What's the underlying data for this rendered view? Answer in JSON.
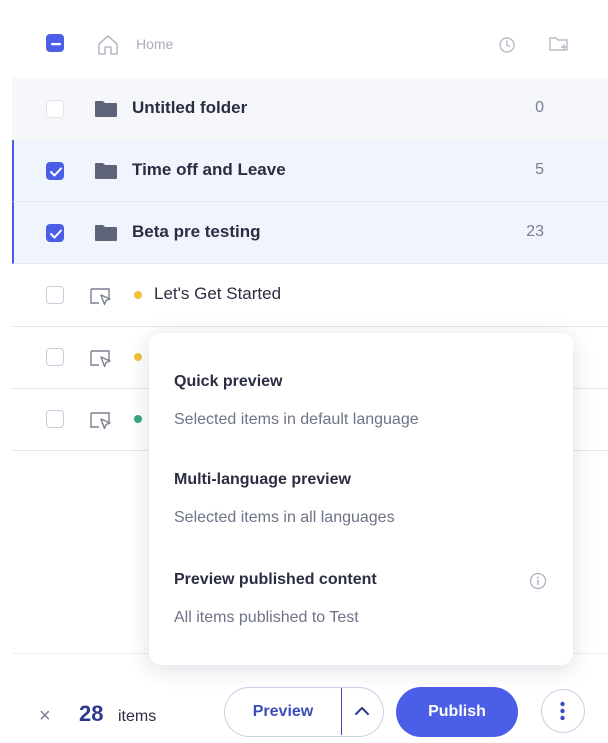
{
  "header": {
    "home_label": "Home",
    "icons": [
      "home-icon",
      "history-icon",
      "new-folder-icon"
    ]
  },
  "rows": [
    {
      "type": "folder",
      "name": "Untitled folder",
      "count": "0",
      "checked": false
    },
    {
      "type": "folder",
      "name": "Time off and Leave",
      "count": "5",
      "checked": true
    },
    {
      "type": "folder",
      "name": "Beta pre testing",
      "count": "23",
      "checked": true
    },
    {
      "type": "item",
      "name": "Let's Get Started",
      "status_color": "#f0c23c",
      "checked": false
    },
    {
      "type": "item",
      "name": "",
      "status_color": "#f0c23c",
      "checked": false
    },
    {
      "type": "item",
      "name": "",
      "status_color": "#3aa682",
      "checked": false
    }
  ],
  "preview_menu": {
    "options": [
      {
        "title": "Quick preview",
        "description": "Selected items in default language"
      },
      {
        "title": "Multi-language preview",
        "description": "Selected items in all languages"
      },
      {
        "title": "Preview published content",
        "description": "All items published to Test",
        "icon": "info-icon"
      }
    ]
  },
  "footer": {
    "close_symbol": "×",
    "selected_count": "28",
    "selected_label": "items",
    "preview_label": "Preview",
    "publish_label": "Publish",
    "more_symbol": "⋮"
  },
  "colors": {
    "accent": "#4a5ee7",
    "text": "#2b2d42",
    "muted": "#7a7f92",
    "status_yellow": "#f0c23c",
    "status_green": "#3aa682"
  }
}
